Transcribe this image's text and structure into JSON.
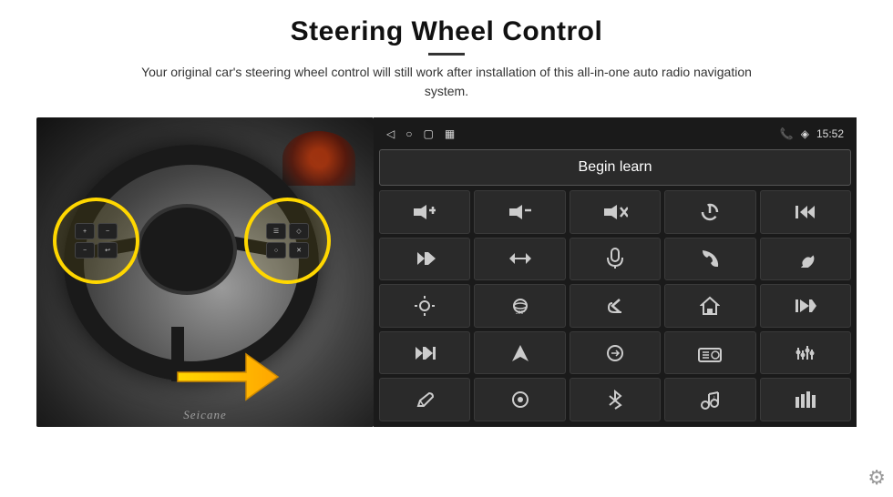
{
  "header": {
    "title": "Steering Wheel Control",
    "subtitle": "Your original car's steering wheel control will still work after installation of this all-in-one auto radio navigation system."
  },
  "status_bar": {
    "back_icon": "◁",
    "circle_icon": "○",
    "square_icon": "▢",
    "signal_icon": "▦",
    "phone_icon": "📞",
    "wifi_icon": "◈",
    "time": "15:52"
  },
  "begin_learn": {
    "label": "Begin learn"
  },
  "icons": [
    {
      "id": "vol-up",
      "symbol": "🔊+",
      "label": "volume up"
    },
    {
      "id": "vol-down",
      "symbol": "🔊-",
      "label": "volume down"
    },
    {
      "id": "vol-mute",
      "symbol": "🔇",
      "label": "mute"
    },
    {
      "id": "power",
      "symbol": "⏻",
      "label": "power"
    },
    {
      "id": "prev-track-end",
      "symbol": "⏮",
      "label": "previous"
    },
    {
      "id": "next",
      "symbol": "⏭",
      "label": "next"
    },
    {
      "id": "prev-next2",
      "symbol": "⏭⏮",
      "label": "prev next"
    },
    {
      "id": "mic",
      "symbol": "🎙",
      "label": "microphone"
    },
    {
      "id": "phone",
      "symbol": "📞",
      "label": "phone"
    },
    {
      "id": "hang-up",
      "symbol": "📵",
      "label": "hang up"
    },
    {
      "id": "brightness",
      "symbol": "🔆",
      "label": "brightness"
    },
    {
      "id": "camera360",
      "symbol": "360",
      "label": "360 camera"
    },
    {
      "id": "back-nav",
      "symbol": "↩",
      "label": "back"
    },
    {
      "id": "home",
      "symbol": "⌂",
      "label": "home"
    },
    {
      "id": "skip-prev",
      "symbol": "⏮",
      "label": "skip previous"
    },
    {
      "id": "skip-next",
      "symbol": "⏭",
      "label": "skip next"
    },
    {
      "id": "navigation",
      "symbol": "▲",
      "label": "navigation"
    },
    {
      "id": "switch",
      "symbol": "⇄",
      "label": "switch"
    },
    {
      "id": "radio",
      "symbol": "📻",
      "label": "radio"
    },
    {
      "id": "equalizer",
      "symbol": "🎚",
      "label": "equalizer"
    },
    {
      "id": "pen",
      "symbol": "✏",
      "label": "pen"
    },
    {
      "id": "settings-ring",
      "symbol": "⊙",
      "label": "settings ring"
    },
    {
      "id": "bluetooth",
      "symbol": "⚡",
      "label": "bluetooth"
    },
    {
      "id": "music",
      "symbol": "🎵",
      "label": "music"
    },
    {
      "id": "sound-bars",
      "symbol": "▐",
      "label": "sound bars"
    }
  ],
  "watermark": "Seicane",
  "gear": {
    "icon": "⚙"
  }
}
